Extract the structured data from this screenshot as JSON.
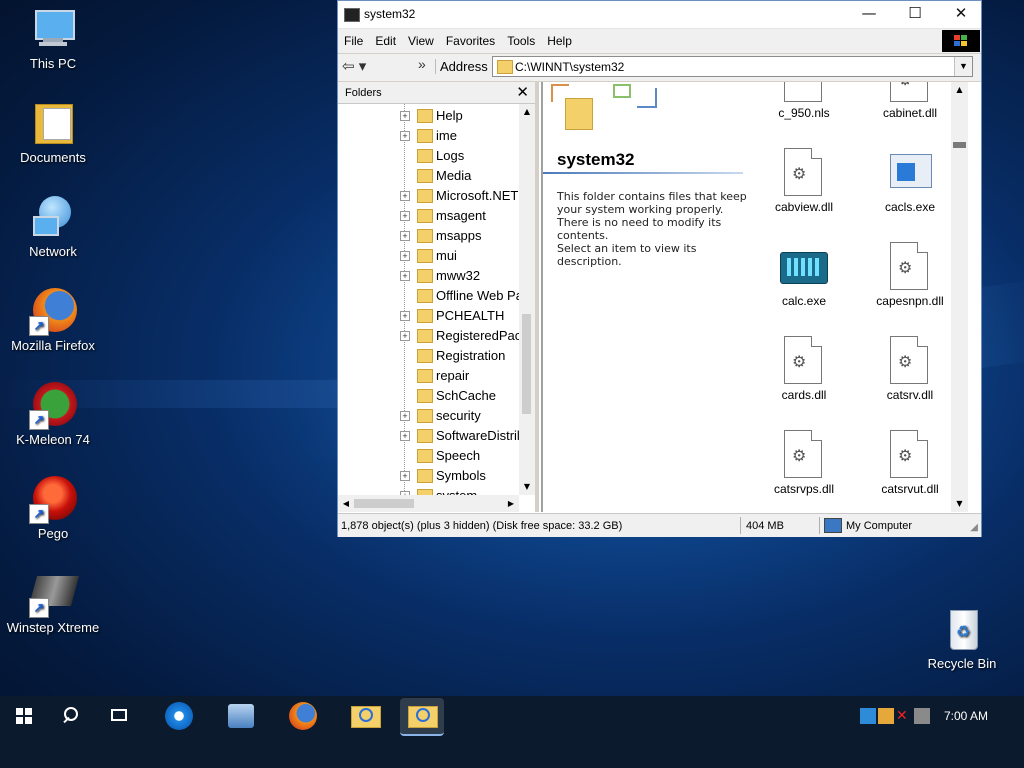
{
  "desktop": {
    "icons": [
      {
        "label": "This PC",
        "icon": "this-pc-icon"
      },
      {
        "label": "Documents",
        "icon": "documents-icon"
      },
      {
        "label": "Network",
        "icon": "network-icon"
      },
      {
        "label": "Mozilla Firefox",
        "icon": "firefox-icon"
      },
      {
        "label": "K-Meleon 74",
        "icon": "k-meleon-icon"
      },
      {
        "label": "Pego",
        "icon": "pego-icon"
      },
      {
        "label": "Winstep Xtreme",
        "icon": "winstep-icon"
      },
      {
        "label": "Recycle Bin",
        "icon": "recycle-bin-icon"
      }
    ]
  },
  "window": {
    "title": "system32",
    "controls": {
      "minimize": "—",
      "maximize": "☐",
      "close": "✕"
    },
    "menu": [
      "File",
      "Edit",
      "View",
      "Favorites",
      "Tools",
      "Help"
    ],
    "address": {
      "label": "Address",
      "value": "C:\\WINNT\\system32"
    },
    "folders_pane": {
      "title": "Folders",
      "close": "✕",
      "items": [
        {
          "name": "Help",
          "expandable": true
        },
        {
          "name": "ime",
          "expandable": true
        },
        {
          "name": "Logs",
          "expandable": false
        },
        {
          "name": "Media",
          "expandable": false
        },
        {
          "name": "Microsoft.NET",
          "expandable": true
        },
        {
          "name": "msagent",
          "expandable": true
        },
        {
          "name": "msapps",
          "expandable": true
        },
        {
          "name": "mui",
          "expandable": true
        },
        {
          "name": "mww32",
          "expandable": true
        },
        {
          "name": "Offline Web Pa",
          "expandable": false
        },
        {
          "name": "PCHEALTH",
          "expandable": true
        },
        {
          "name": "RegisteredPac",
          "expandable": true
        },
        {
          "name": "Registration",
          "expandable": false
        },
        {
          "name": "repair",
          "expandable": false
        },
        {
          "name": "SchCache",
          "expandable": false
        },
        {
          "name": "security",
          "expandable": true
        },
        {
          "name": "SoftwareDistril",
          "expandable": true
        },
        {
          "name": "Speech",
          "expandable": false
        },
        {
          "name": "Symbols",
          "expandable": true
        },
        {
          "name": "system",
          "expandable": true
        }
      ]
    },
    "info": {
      "heading": "system32",
      "text1": "This folder contains files that keep your system working properly. There is no need to modify its contents.",
      "text2": "Select an item to view its description."
    },
    "files": [
      {
        "name": "c_950.nls",
        "icon": "doc-icon"
      },
      {
        "name": "cabinet.dll",
        "icon": "dll-icon"
      },
      {
        "name": "cabview.dll",
        "icon": "dll-icon"
      },
      {
        "name": "cacls.exe",
        "icon": "exe-window-icon"
      },
      {
        "name": "calc.exe",
        "icon": "calculator-icon"
      },
      {
        "name": "capesnpn.dll",
        "icon": "dll-icon"
      },
      {
        "name": "cards.dll",
        "icon": "dll-icon"
      },
      {
        "name": "catsrv.dll",
        "icon": "dll-icon"
      },
      {
        "name": "catsrvps.dll",
        "icon": "dll-icon"
      },
      {
        "name": "catsrvut.dll",
        "icon": "dll-icon"
      }
    ],
    "status": {
      "objects": "1,878 object(s) (plus 3 hidden) (Disk free space: 33.2 GB)",
      "size": "404 MB",
      "location": "My Computer"
    }
  },
  "taskbar": {
    "clock": "7:00 AM",
    "apps": [
      "start",
      "search",
      "task-view",
      "internet-explorer",
      "winstep",
      "firefox",
      "file-search",
      "file-search-active"
    ]
  }
}
